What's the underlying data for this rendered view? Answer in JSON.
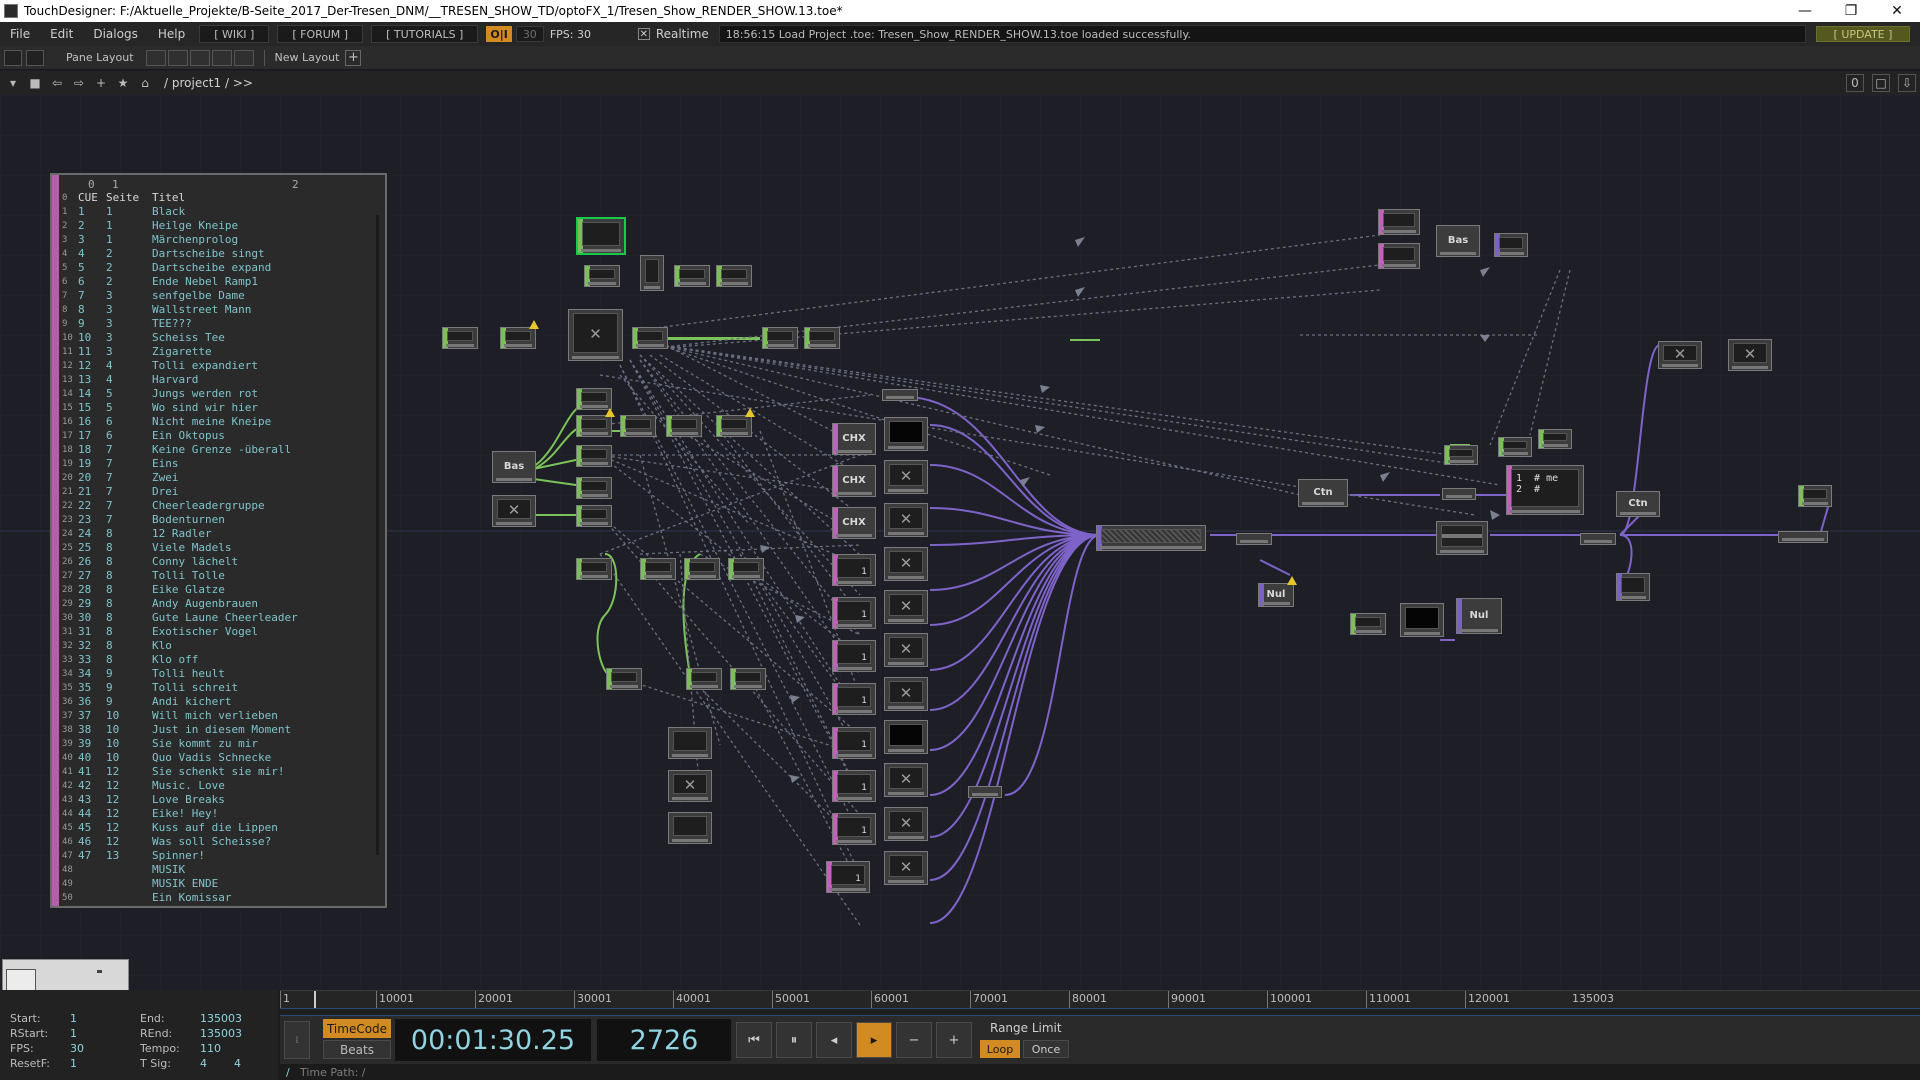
{
  "window": {
    "title": "TouchDesigner: F:/Aktuelle_Projekte/B-Seite_2017_Der-Tresen_DNM/__TRESEN_SHOW_TD/optoFX_1/Tresen_Show_RENDER_SHOW.13.toe*",
    "min": "—",
    "max": "❐",
    "close": "✕"
  },
  "menu": {
    "items": [
      "File",
      "Edit",
      "Dialogs",
      "Help"
    ],
    "wiki": "[ WIKI ]",
    "forum": "[ FORUM ]",
    "tutorials": "[ TUTORIALS ]",
    "oi": "O|I",
    "fps_box": "30",
    "fps_label": "FPS:  30",
    "realtime": "Realtime",
    "status": "18:56:15 Load Project .toe: Tresen_Show_RENDER_SHOW.13.toe loaded successfully.",
    "update": "[ UPDATE ]"
  },
  "panebar": {
    "pane_layout": "Pane Layout",
    "new_layout": "New Layout",
    "plus": "+"
  },
  "pathbar": {
    "path": "/ project1 / >>",
    "right": [
      "0",
      "□",
      "⇩"
    ]
  },
  "table": {
    "headers": [
      "0",
      "1",
      "2"
    ],
    "rows": [
      [
        "0",
        "CUE",
        "Seite",
        "Titel"
      ],
      [
        "1",
        "1",
        "1",
        "Black"
      ],
      [
        "2",
        "2",
        "1",
        "Heilge Kneipe"
      ],
      [
        "3",
        "3",
        "1",
        "Märchenprolog"
      ],
      [
        "4",
        "4",
        "2",
        "Dartscheibe singt"
      ],
      [
        "5",
        "5",
        "2",
        "Dartscheibe expand"
      ],
      [
        "6",
        "6",
        "2",
        "Ende Nebel Ramp1"
      ],
      [
        "7",
        "7",
        "3",
        "senfgelbe Dame"
      ],
      [
        "8",
        "8",
        "3",
        "Wallstreet Mann"
      ],
      [
        "9",
        "9",
        "3",
        "TEE???"
      ],
      [
        "10",
        "10",
        "3",
        "Scheiss Tee"
      ],
      [
        "11",
        "11",
        "3",
        "Zigarette"
      ],
      [
        "12",
        "12",
        "4",
        "Tolli expandiert"
      ],
      [
        "13",
        "13",
        "4",
        "Harvard"
      ],
      [
        "14",
        "14",
        "5",
        "Jungs werden rot"
      ],
      [
        "15",
        "15",
        "5",
        "Wo sind wir hier"
      ],
      [
        "16",
        "16",
        "6",
        "Nicht meine Kneipe"
      ],
      [
        "17",
        "17",
        "6",
        "Ein Oktopus"
      ],
      [
        "18",
        "18",
        "7",
        "Keine Grenze -überall"
      ],
      [
        "19",
        "19",
        "7",
        "Eins"
      ],
      [
        "20",
        "20",
        "7",
        "Zwei"
      ],
      [
        "21",
        "21",
        "7",
        "Drei"
      ],
      [
        "22",
        "22",
        "7",
        "Cheerleadergruppe"
      ],
      [
        "23",
        "23",
        "7",
        "Bodenturnen"
      ],
      [
        "24",
        "24",
        "8",
        "12 Radler"
      ],
      [
        "25",
        "25",
        "8",
        "Viele Madels"
      ],
      [
        "26",
        "26",
        "8",
        "Conny lächelt"
      ],
      [
        "27",
        "27",
        "8",
        "Tolli Tolle"
      ],
      [
        "28",
        "28",
        "8",
        "Eike Glatze"
      ],
      [
        "29",
        "29",
        "8",
        "Andy Augenbrauen"
      ],
      [
        "30",
        "30",
        "8",
        "Gute Laune Cheerleader"
      ],
      [
        "31",
        "31",
        "8",
        "Exotischer Vogel"
      ],
      [
        "32",
        "32",
        "8",
        "Klo"
      ],
      [
        "33",
        "33",
        "8",
        "Klo off"
      ],
      [
        "34",
        "34",
        "9",
        "Tolli heult"
      ],
      [
        "35",
        "35",
        "9",
        "Tolli schreit"
      ],
      [
        "36",
        "36",
        "9",
        "Andi kichert"
      ],
      [
        "37",
        "37",
        "10",
        "Will mich verlieben"
      ],
      [
        "38",
        "38",
        "10",
        "Just in diesem Moment"
      ],
      [
        "39",
        "39",
        "10",
        "Sie kommt zu mir"
      ],
      [
        "40",
        "40",
        "10",
        "Quo Vadis Schnecke"
      ],
      [
        "41",
        "41",
        "12",
        "Sie schenkt sie mir!"
      ],
      [
        "42",
        "42",
        "12",
        "Music. Love"
      ],
      [
        "43",
        "43",
        "12",
        "Love Breaks"
      ],
      [
        "44",
        "44",
        "12",
        "Eike! Hey!"
      ],
      [
        "45",
        "45",
        "12",
        "Kuss auf die Lippen"
      ],
      [
        "46",
        "46",
        "12",
        "Was soll Scheisse?"
      ],
      [
        "47",
        "47",
        "13",
        "Spinner!"
      ],
      [
        "48",
        "",
        "",
        "MUSIK"
      ],
      [
        "49",
        "",
        "",
        "MUSIK ENDE"
      ],
      [
        "50",
        "",
        "",
        "Ein Komissar"
      ]
    ]
  },
  "nodes": {
    "bas1": "Bas",
    "bas2": "Bas",
    "chx1": "CHX",
    "chx2": "CHX",
    "chx3": "CHX",
    "ctn1": "Ctn",
    "ctn2": "Ctn",
    "nul1": "Nul",
    "nul2": "Nul",
    "one": "1",
    "script": "1  # me\n2  #"
  },
  "ruler": {
    "ticks": [
      "1",
      "10001",
      "20001",
      "30001",
      "40001",
      "50001",
      "60001",
      "70001",
      "80001",
      "90001",
      "100001",
      "110001",
      "120001",
      "135003"
    ]
  },
  "info": {
    "start_label": "Start:",
    "start": "1",
    "rstart_label": "RStart:",
    "rstart": "1",
    "fps_label": "FPS:",
    "fps": "30",
    "resetf_label": "ResetF:",
    "resetf": "1",
    "end_label": "End:",
    "end": "135003",
    "rend_label": "REnd:",
    "rend": "135003",
    "tempo_label": "Tempo:",
    "tempo": "110",
    "tsig_label": "T Sig:",
    "tsig_a": "4",
    "tsig_b": "4"
  },
  "transport": {
    "timecode_btn": "TimeCode",
    "beats_btn": "Beats",
    "timecode": "00:01:30.25",
    "frame": "2726",
    "range_limit": "Range Limit",
    "loop": "Loop",
    "once": "Once"
  },
  "timepath": {
    "label": "Time Path: /"
  }
}
